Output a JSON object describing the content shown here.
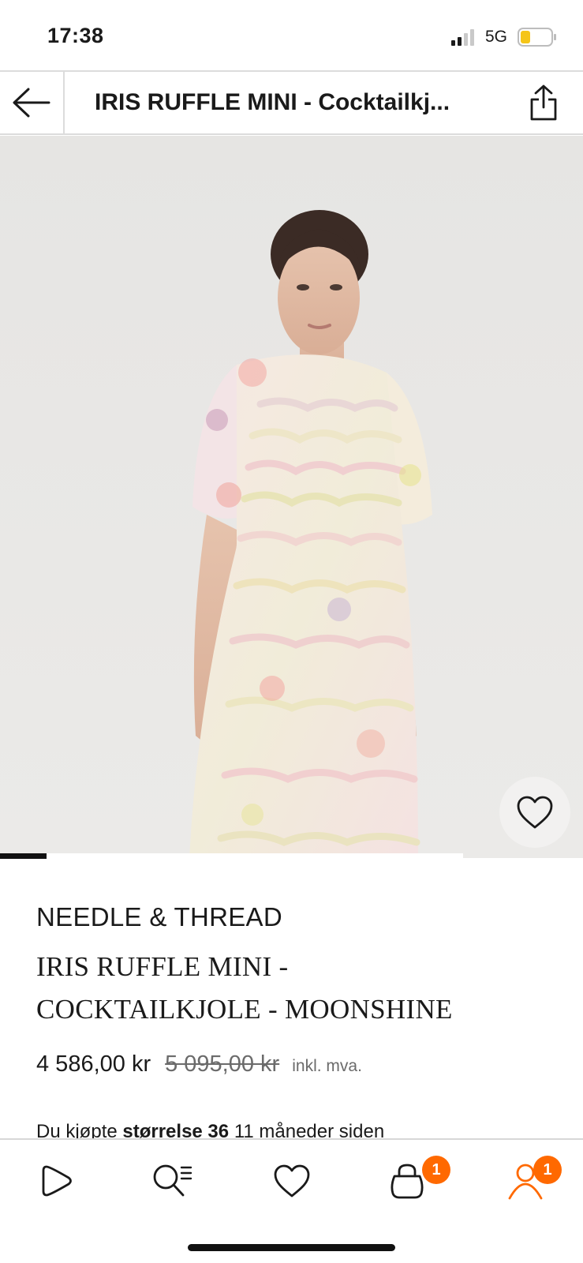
{
  "status_bar": {
    "time": "17:38",
    "network": "5G",
    "signal_icon": "signal-bars-icon",
    "battery_icon": "battery-low-icon",
    "battery_color": "#f5c518"
  },
  "header": {
    "title": "IRIS RUFFLE MINI - Cocktailkj...",
    "back_icon": "arrow-left-icon",
    "share_icon": "share-icon"
  },
  "product": {
    "image_alt": "product-photo",
    "gallery_progress": 0.1,
    "brand": "NEEDLE & THREAD",
    "title_line1": "IRIS RUFFLE MINI -",
    "title_line2": "COCKTAILKJOLE - MOONSHINE",
    "price_current": "4 586,00 kr",
    "price_original": "5 095,00 kr",
    "price_vat": "inkl. mva.",
    "purchase_note_prefix": "Du kjøpte",
    "purchase_note_size": "størrelse 36",
    "purchase_note_suffix": "11 måneder siden"
  },
  "bottom_nav": {
    "items": [
      {
        "icon": "home-play-icon"
      },
      {
        "icon": "search-list-icon"
      },
      {
        "icon": "heart-icon"
      },
      {
        "icon": "bag-icon",
        "badge": "1"
      },
      {
        "icon": "profile-icon",
        "badge": "1"
      }
    ],
    "accent_color": "#ff6900"
  }
}
